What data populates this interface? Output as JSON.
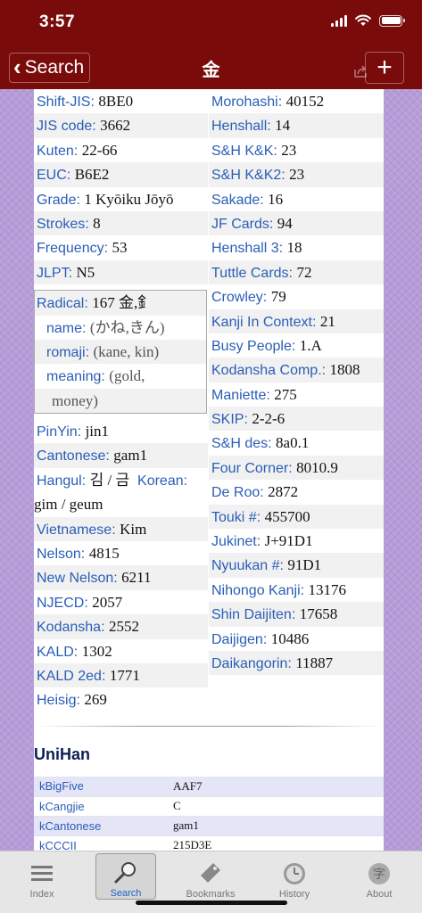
{
  "status": {
    "time": "3:57"
  },
  "nav": {
    "back_label": "Search",
    "title": "金",
    "add_label": "+"
  },
  "left_rows": [
    {
      "label": "Shift-JIS:",
      "value": "8BE0"
    },
    {
      "label": "JIS code:",
      "value": "3662"
    },
    {
      "label": "Kuten:",
      "value": "22-66"
    },
    {
      "label": "EUC:",
      "value": "B6E2"
    },
    {
      "label": "Grade:",
      "value": "1 Kyōiku Jōyō"
    },
    {
      "label": "Strokes:",
      "value": "8"
    },
    {
      "label": "Frequency:",
      "value": "53"
    },
    {
      "label": "JLPT:",
      "value": "N5"
    }
  ],
  "radical": {
    "label": "Radical:",
    "value": "167 金,釒",
    "name_label": "name:",
    "name_value": "(かね,きん)",
    "romaji_label": "romaji:",
    "romaji_value": "(kane, kin)",
    "meaning_label": "meaning:",
    "meaning_value": "(gold,",
    "meaning_cont": "money)"
  },
  "left_rows2": [
    {
      "label": "PinYin:",
      "value": "jin1"
    },
    {
      "label": "Cantonese:",
      "value": "gam1"
    }
  ],
  "hangul": {
    "label": "Hangul:",
    "value": "김 / 금",
    "korean_label": "Korean:",
    "korean_value": "gim / geum"
  },
  "left_rows3": [
    {
      "label": "Vietnamese:",
      "value": "Kim"
    },
    {
      "label": "Nelson:",
      "value": "4815"
    },
    {
      "label": "New Nelson:",
      "value": "6211"
    },
    {
      "label": "NJECD:",
      "value": "2057"
    },
    {
      "label": "Kodansha:",
      "value": "2552"
    },
    {
      "label": "KALD:",
      "value": "1302"
    },
    {
      "label": "KALD 2ed:",
      "value": "1771"
    },
    {
      "label": "Heisig:",
      "value": "269"
    }
  ],
  "right_rows": [
    {
      "label": "Morohashi:",
      "value": "40152"
    },
    {
      "label": "Henshall:",
      "value": "14"
    },
    {
      "label": "S&H K&K:",
      "value": "23"
    },
    {
      "label": "S&H K&K2:",
      "value": "23"
    },
    {
      "label": "Sakade:",
      "value": "16"
    },
    {
      "label": "JF Cards:",
      "value": "94"
    },
    {
      "label": "Henshall 3:",
      "value": "18"
    },
    {
      "label": "Tuttle Cards:",
      "value": "72"
    },
    {
      "label": "Crowley:",
      "value": "79"
    },
    {
      "label": "Kanji In Context:",
      "value": "21"
    },
    {
      "label": "Busy People:",
      "value": "1.A"
    },
    {
      "label": "Kodansha Comp.:",
      "value": "1808"
    },
    {
      "label": "Maniette:",
      "value": "275"
    },
    {
      "label": "SKIP:",
      "value": "2-2-6"
    },
    {
      "label": "S&H des:",
      "value": "8a0.1"
    },
    {
      "label": "Four Corner:",
      "value": "8010.9"
    },
    {
      "label": "De Roo:",
      "value": "2872"
    },
    {
      "label": "Touki #:",
      "value": "455700"
    },
    {
      "label": "Jukinet:",
      "value": "J+91D1"
    },
    {
      "label": "Nyuukan #:",
      "value": "91D1"
    },
    {
      "label": "Nihongo Kanji:",
      "value": "13176"
    },
    {
      "label": "Shin Daijiten:",
      "value": "17658"
    },
    {
      "label": "Daijigen:",
      "value": "10486"
    },
    {
      "label": "Daikangorin:",
      "value": "11887"
    }
  ],
  "unihan": {
    "title": "UniHan",
    "rows": [
      {
        "key": "kBigFive",
        "value": "AAF7"
      },
      {
        "key": "kCangjie",
        "value": "C"
      },
      {
        "key": "kCantonese",
        "value": "gam1"
      },
      {
        "key": "kCCCII",
        "value": "215D3E"
      }
    ]
  },
  "tabs": [
    {
      "label": "Index",
      "icon": "list-icon"
    },
    {
      "label": "Search",
      "icon": "magnifier-icon",
      "active": true
    },
    {
      "label": "Bookmarks",
      "icon": "bookmark-tag-icon"
    },
    {
      "label": "History",
      "icon": "clock-icon"
    },
    {
      "label": "About",
      "icon": "kanji-about-icon"
    }
  ],
  "colors": {
    "nav_bg": "#7a0b0b",
    "label_blue": "#2a5eb6",
    "active_tab": "#1f62c8",
    "page_bg": "#b69dd8"
  }
}
